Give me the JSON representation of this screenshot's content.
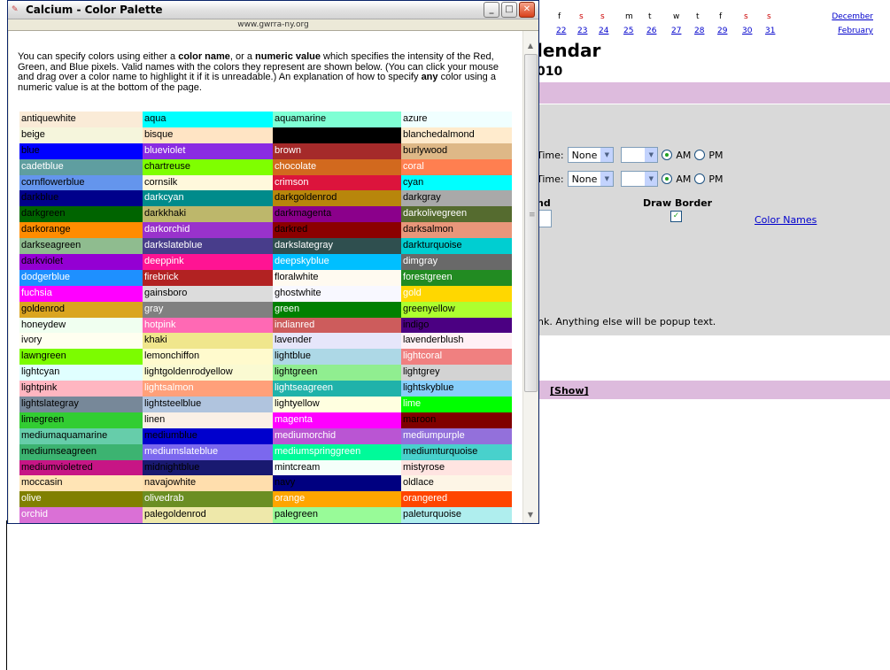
{
  "background_page": {
    "mini_calendar": {
      "day_headers": [
        "f",
        "s",
        "s",
        "m",
        "t",
        "w",
        "t",
        "f",
        "s",
        "s"
      ],
      "dates": [
        "22",
        "23",
        "24",
        "25",
        "26",
        "27",
        "28",
        "29",
        "30",
        "31"
      ],
      "prev_month": "December",
      "next_month": "February"
    },
    "title_fragment": "lendar",
    "subtitle_fragment": "010",
    "start_time": {
      "label": "Time:",
      "hour": "None",
      "minute": "",
      "am": "AM",
      "pm": "PM"
    },
    "end_time": {
      "label": "Time:",
      "hour": "None",
      "minute": "",
      "am": "AM",
      "pm": "PM"
    },
    "field_label_fragment": "nd",
    "draw_border_label": "Draw Border",
    "color_names_link": "Color Names",
    "help_text_fragment": "ink. Anything else will be popup text.",
    "show_link": "[Show]"
  },
  "popup": {
    "title": "Calcium - Color Palette",
    "url": "www.gwrra-ny.org",
    "intro": {
      "p1": "You can specify colors using either a ",
      "b1": "color name",
      "p2": ", or a ",
      "b2": "numeric value",
      "p3": " which specifies the intensity of the Red, Green, and Blue pixels. Valid names with the colors they represent are shown below. (You can click your mouse and drag over a color name to highlight it if it is unreadable.) An explanation of how to specify ",
      "b3": "any",
      "p4": " color using a numeric value is at the bottom of the page."
    },
    "colors": [
      {
        "name": "antiquewhite",
        "bg": "#faebd7",
        "fg": "#000000"
      },
      {
        "name": "aqua",
        "bg": "#00ffff",
        "fg": "#000000"
      },
      {
        "name": "aquamarine",
        "bg": "#7fffd4",
        "fg": "#000000"
      },
      {
        "name": "azure",
        "bg": "#f0ffff",
        "fg": "#000000"
      },
      {
        "name": "beige",
        "bg": "#f5f5dc",
        "fg": "#000000"
      },
      {
        "name": "bisque",
        "bg": "#ffe4c4",
        "fg": "#000000"
      },
      {
        "name": "black",
        "bg": "#000000",
        "fg": "#000000"
      },
      {
        "name": "blanchedalmond",
        "bg": "#ffebcd",
        "fg": "#000000"
      },
      {
        "name": "blue",
        "bg": "#0000ff",
        "fg": "#000000"
      },
      {
        "name": "blueviolet",
        "bg": "#8a2be2",
        "fg": "#ffffff"
      },
      {
        "name": "brown",
        "bg": "#a52a2a",
        "fg": "#ffffff"
      },
      {
        "name": "burlywood",
        "bg": "#deb887",
        "fg": "#000000"
      },
      {
        "name": "cadetblue",
        "bg": "#5f9ea0",
        "fg": "#ffffff"
      },
      {
        "name": "chartreuse",
        "bg": "#7fff00",
        "fg": "#000000"
      },
      {
        "name": "chocolate",
        "bg": "#d2691e",
        "fg": "#ffffff"
      },
      {
        "name": "coral",
        "bg": "#ff7f50",
        "fg": "#ffffff"
      },
      {
        "name": "cornflowerblue",
        "bg": "#6495ed",
        "fg": "#000000"
      },
      {
        "name": "cornsilk",
        "bg": "#fff8dc",
        "fg": "#000000"
      },
      {
        "name": "crimson",
        "bg": "#dc143c",
        "fg": "#ffffff"
      },
      {
        "name": "cyan",
        "bg": "#00ffff",
        "fg": "#000000"
      },
      {
        "name": "darkblue",
        "bg": "#00008b",
        "fg": "#000000"
      },
      {
        "name": "darkcyan",
        "bg": "#008b8b",
        "fg": "#ffffff"
      },
      {
        "name": "darkgoldenrod",
        "bg": "#b8860b",
        "fg": "#000000"
      },
      {
        "name": "darkgray",
        "bg": "#a9a9a9",
        "fg": "#000000"
      },
      {
        "name": "darkgreen",
        "bg": "#006400",
        "fg": "#000000"
      },
      {
        "name": "darkkhaki",
        "bg": "#bdb76b",
        "fg": "#000000"
      },
      {
        "name": "darkmagenta",
        "bg": "#8b008b",
        "fg": "#000000"
      },
      {
        "name": "darkolivegreen",
        "bg": "#556b2f",
        "fg": "#ffffff"
      },
      {
        "name": "darkorange",
        "bg": "#ff8c00",
        "fg": "#000000"
      },
      {
        "name": "darkorchid",
        "bg": "#9932cc",
        "fg": "#ffffff"
      },
      {
        "name": "darkred",
        "bg": "#8b0000",
        "fg": "#000000"
      },
      {
        "name": "darksalmon",
        "bg": "#e9967a",
        "fg": "#000000"
      },
      {
        "name": "darkseagreen",
        "bg": "#8fbc8f",
        "fg": "#000000"
      },
      {
        "name": "darkslateblue",
        "bg": "#483d8b",
        "fg": "#ffffff"
      },
      {
        "name": "darkslategray",
        "bg": "#2f4f4f",
        "fg": "#ffffff"
      },
      {
        "name": "darkturquoise",
        "bg": "#00ced1",
        "fg": "#000000"
      },
      {
        "name": "darkviolet",
        "bg": "#9400d3",
        "fg": "#000000"
      },
      {
        "name": "deeppink",
        "bg": "#ff1493",
        "fg": "#ffffff"
      },
      {
        "name": "deepskyblue",
        "bg": "#00bfff",
        "fg": "#ffffff"
      },
      {
        "name": "dimgray",
        "bg": "#696969",
        "fg": "#ffffff"
      },
      {
        "name": "dodgerblue",
        "bg": "#1e90ff",
        "fg": "#ffffff"
      },
      {
        "name": "firebrick",
        "bg": "#b22222",
        "fg": "#ffffff"
      },
      {
        "name": "floralwhite",
        "bg": "#fffaf0",
        "fg": "#000000"
      },
      {
        "name": "forestgreen",
        "bg": "#228b22",
        "fg": "#ffffff"
      },
      {
        "name": "fuchsia",
        "bg": "#ff00ff",
        "fg": "#ffffff"
      },
      {
        "name": "gainsboro",
        "bg": "#dcdcdc",
        "fg": "#000000"
      },
      {
        "name": "ghostwhite",
        "bg": "#f8f8ff",
        "fg": "#000000"
      },
      {
        "name": "gold",
        "bg": "#ffd700",
        "fg": "#ffffff"
      },
      {
        "name": "goldenrod",
        "bg": "#daa520",
        "fg": "#000000"
      },
      {
        "name": "gray",
        "bg": "#808080",
        "fg": "#ffffff"
      },
      {
        "name": "green",
        "bg": "#008000",
        "fg": "#ffffff"
      },
      {
        "name": "greenyellow",
        "bg": "#adff2f",
        "fg": "#000000"
      },
      {
        "name": "honeydew",
        "bg": "#f0fff0",
        "fg": "#000000"
      },
      {
        "name": "hotpink",
        "bg": "#ff69b4",
        "fg": "#ffffff"
      },
      {
        "name": "indianred",
        "bg": "#cd5c5c",
        "fg": "#ffffff"
      },
      {
        "name": "indigo",
        "bg": "#4b0082",
        "fg": "#000000"
      },
      {
        "name": "ivory",
        "bg": "#fffff0",
        "fg": "#000000"
      },
      {
        "name": "khaki",
        "bg": "#f0e68c",
        "fg": "#000000"
      },
      {
        "name": "lavender",
        "bg": "#e6e6fa",
        "fg": "#000000"
      },
      {
        "name": "lavenderblush",
        "bg": "#fff0f5",
        "fg": "#000000"
      },
      {
        "name": "lawngreen",
        "bg": "#7cfc00",
        "fg": "#000000"
      },
      {
        "name": "lemonchiffon",
        "bg": "#fffacd",
        "fg": "#000000"
      },
      {
        "name": "lightblue",
        "bg": "#add8e6",
        "fg": "#000000"
      },
      {
        "name": "lightcoral",
        "bg": "#f08080",
        "fg": "#ffffff"
      },
      {
        "name": "lightcyan",
        "bg": "#e0ffff",
        "fg": "#000000"
      },
      {
        "name": "lightgoldenrodyellow",
        "bg": "#fafad2",
        "fg": "#000000"
      },
      {
        "name": "lightgreen",
        "bg": "#90ee90",
        "fg": "#000000"
      },
      {
        "name": "lightgrey",
        "bg": "#d3d3d3",
        "fg": "#000000"
      },
      {
        "name": "lightpink",
        "bg": "#ffb6c1",
        "fg": "#000000"
      },
      {
        "name": "lightsalmon",
        "bg": "#ffa07a",
        "fg": "#ffffff"
      },
      {
        "name": "lightseagreen",
        "bg": "#20b2aa",
        "fg": "#ffffff"
      },
      {
        "name": "lightskyblue",
        "bg": "#87cefa",
        "fg": "#000000"
      },
      {
        "name": "lightslategray",
        "bg": "#778899",
        "fg": "#000000"
      },
      {
        "name": "lightsteelblue",
        "bg": "#b0c4de",
        "fg": "#000000"
      },
      {
        "name": "lightyellow",
        "bg": "#ffffe0",
        "fg": "#000000"
      },
      {
        "name": "lime",
        "bg": "#00ff00",
        "fg": "#ffffff"
      },
      {
        "name": "limegreen",
        "bg": "#32cd32",
        "fg": "#000000"
      },
      {
        "name": "linen",
        "bg": "#faf0e6",
        "fg": "#000000"
      },
      {
        "name": "magenta",
        "bg": "#ff00ff",
        "fg": "#ffffff"
      },
      {
        "name": "maroon",
        "bg": "#800000",
        "fg": "#000000"
      },
      {
        "name": "mediumaquamarine",
        "bg": "#66cdaa",
        "fg": "#000000"
      },
      {
        "name": "mediumblue",
        "bg": "#0000cd",
        "fg": "#000000"
      },
      {
        "name": "mediumorchid",
        "bg": "#ba55d3",
        "fg": "#ffffff"
      },
      {
        "name": "mediumpurple",
        "bg": "#9370db",
        "fg": "#ffffff"
      },
      {
        "name": "mediumseagreen",
        "bg": "#3cb371",
        "fg": "#000000"
      },
      {
        "name": "mediumslateblue",
        "bg": "#7b68ee",
        "fg": "#ffffff"
      },
      {
        "name": "mediumspringgreen",
        "bg": "#00fa9a",
        "fg": "#ffffff"
      },
      {
        "name": "mediumturquoise",
        "bg": "#48d1cc",
        "fg": "#000000"
      },
      {
        "name": "mediumvioletred",
        "bg": "#c71585",
        "fg": "#000000"
      },
      {
        "name": "midnightblue",
        "bg": "#191970",
        "fg": "#000000"
      },
      {
        "name": "mintcream",
        "bg": "#f5fffa",
        "fg": "#000000"
      },
      {
        "name": "mistyrose",
        "bg": "#ffe4e1",
        "fg": "#000000"
      },
      {
        "name": "moccasin",
        "bg": "#ffe4b5",
        "fg": "#000000"
      },
      {
        "name": "navajowhite",
        "bg": "#ffdead",
        "fg": "#000000"
      },
      {
        "name": "navy",
        "bg": "#000080",
        "fg": "#000000"
      },
      {
        "name": "oldlace",
        "bg": "#fdf5e6",
        "fg": "#000000"
      },
      {
        "name": "olive",
        "bg": "#808000",
        "fg": "#ffffff"
      },
      {
        "name": "olivedrab",
        "bg": "#6b8e23",
        "fg": "#ffffff"
      },
      {
        "name": "orange",
        "bg": "#ffa500",
        "fg": "#ffffff"
      },
      {
        "name": "orangered",
        "bg": "#ff4500",
        "fg": "#ffffff"
      },
      {
        "name": "orchid",
        "bg": "#da70d6",
        "fg": "#ffffff"
      },
      {
        "name": "palegoldenrod",
        "bg": "#eee8aa",
        "fg": "#000000"
      },
      {
        "name": "palegreen",
        "bg": "#98fb98",
        "fg": "#000000"
      },
      {
        "name": "paleturquoise",
        "bg": "#afeeee",
        "fg": "#000000"
      }
    ]
  }
}
